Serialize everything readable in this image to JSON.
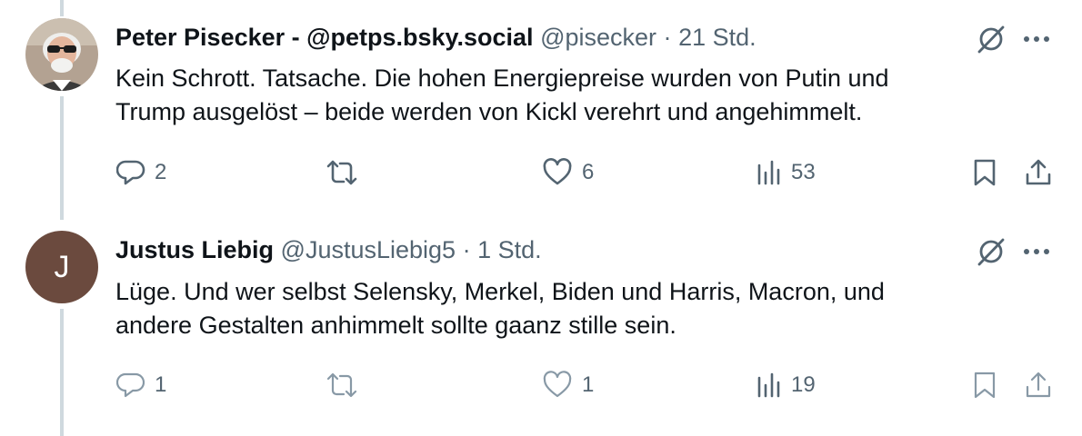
{
  "tweets": [
    {
      "display_name": "Peter Pisecker - @petps.bsky.social",
      "handle": "@pisecker",
      "separator": "·",
      "time": "21 Std.",
      "text_line1": "Kein Schrott. Tatsache. Die hohen Energiepreise wurden von Putin und",
      "text_line2": "Trump ausgelöst – beide werden von Kickl verehrt und angehimmelt.",
      "replies": "2",
      "reposts": "",
      "likes": "6",
      "views": "53",
      "avatar_icon": "user-photo-avatar"
    },
    {
      "display_name": "Justus Liebig",
      "handle": "@JustusLiebig5",
      "separator": "·",
      "time": "1 Std.",
      "text_line1": "Lüge. Und wer selbst Selensky, Merkel, Biden und Harris, Macron, und",
      "text_line2": "andere Gestalten anhimmelt sollte gaanz stille sein.",
      "replies": "1",
      "reposts": "",
      "likes": "1",
      "views": "19",
      "avatar_letter": "J"
    }
  ],
  "icons": [
    "grok-icon",
    "more-icon",
    "reply-icon",
    "repost-icon",
    "like-icon",
    "views-icon",
    "bookmark-icon",
    "share-icon"
  ],
  "colors": {
    "secondary_text": "#536471",
    "muted_icon": "#8899a6",
    "thread_line": "#cfd9de",
    "avatar_letter_bg": "#6b4a3e"
  }
}
